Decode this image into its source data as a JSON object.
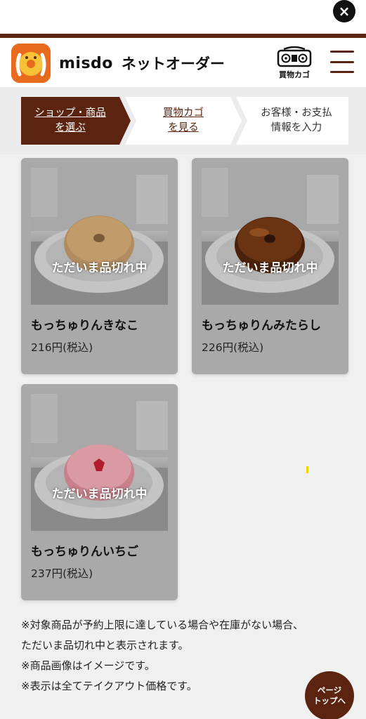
{
  "header": {
    "close_label": "×",
    "brand_en": "misdo",
    "brand_jp": "ネットオーダー",
    "cart_label": "買物カゴ"
  },
  "steps": [
    {
      "line1": "ショップ・商品",
      "line2": "を選ぶ"
    },
    {
      "line1": "買物カゴ",
      "line2": "を見る"
    },
    {
      "line1": "お客様・お支払",
      "line2": "情報を入力"
    }
  ],
  "products": [
    {
      "name": "もっちゅりんきなこ",
      "price": "216円(税込)",
      "status": "ただいま品切れ中"
    },
    {
      "name": "もっちゅりんみたらし",
      "price": "226円(税込)",
      "status": "ただいま品切れ中"
    },
    {
      "name": "もっちゅりんいちご",
      "price": "237円(税込)",
      "status": "ただいま品切れ中"
    }
  ],
  "notes": [
    "※対象商品が予約上限に達している場合や在庫がない場合、",
    "ただいま品切れ中と表示されます。",
    "※商品画像はイメージです。",
    "※表示は全てテイクアウト価格です。"
  ],
  "page_top": {
    "line1": "ページ",
    "line2": "トップへ"
  },
  "colors": {
    "brand_brown": "#5a2410",
    "logo_orange": "#e86a1c",
    "card_gray": "#a9a9a9"
  }
}
